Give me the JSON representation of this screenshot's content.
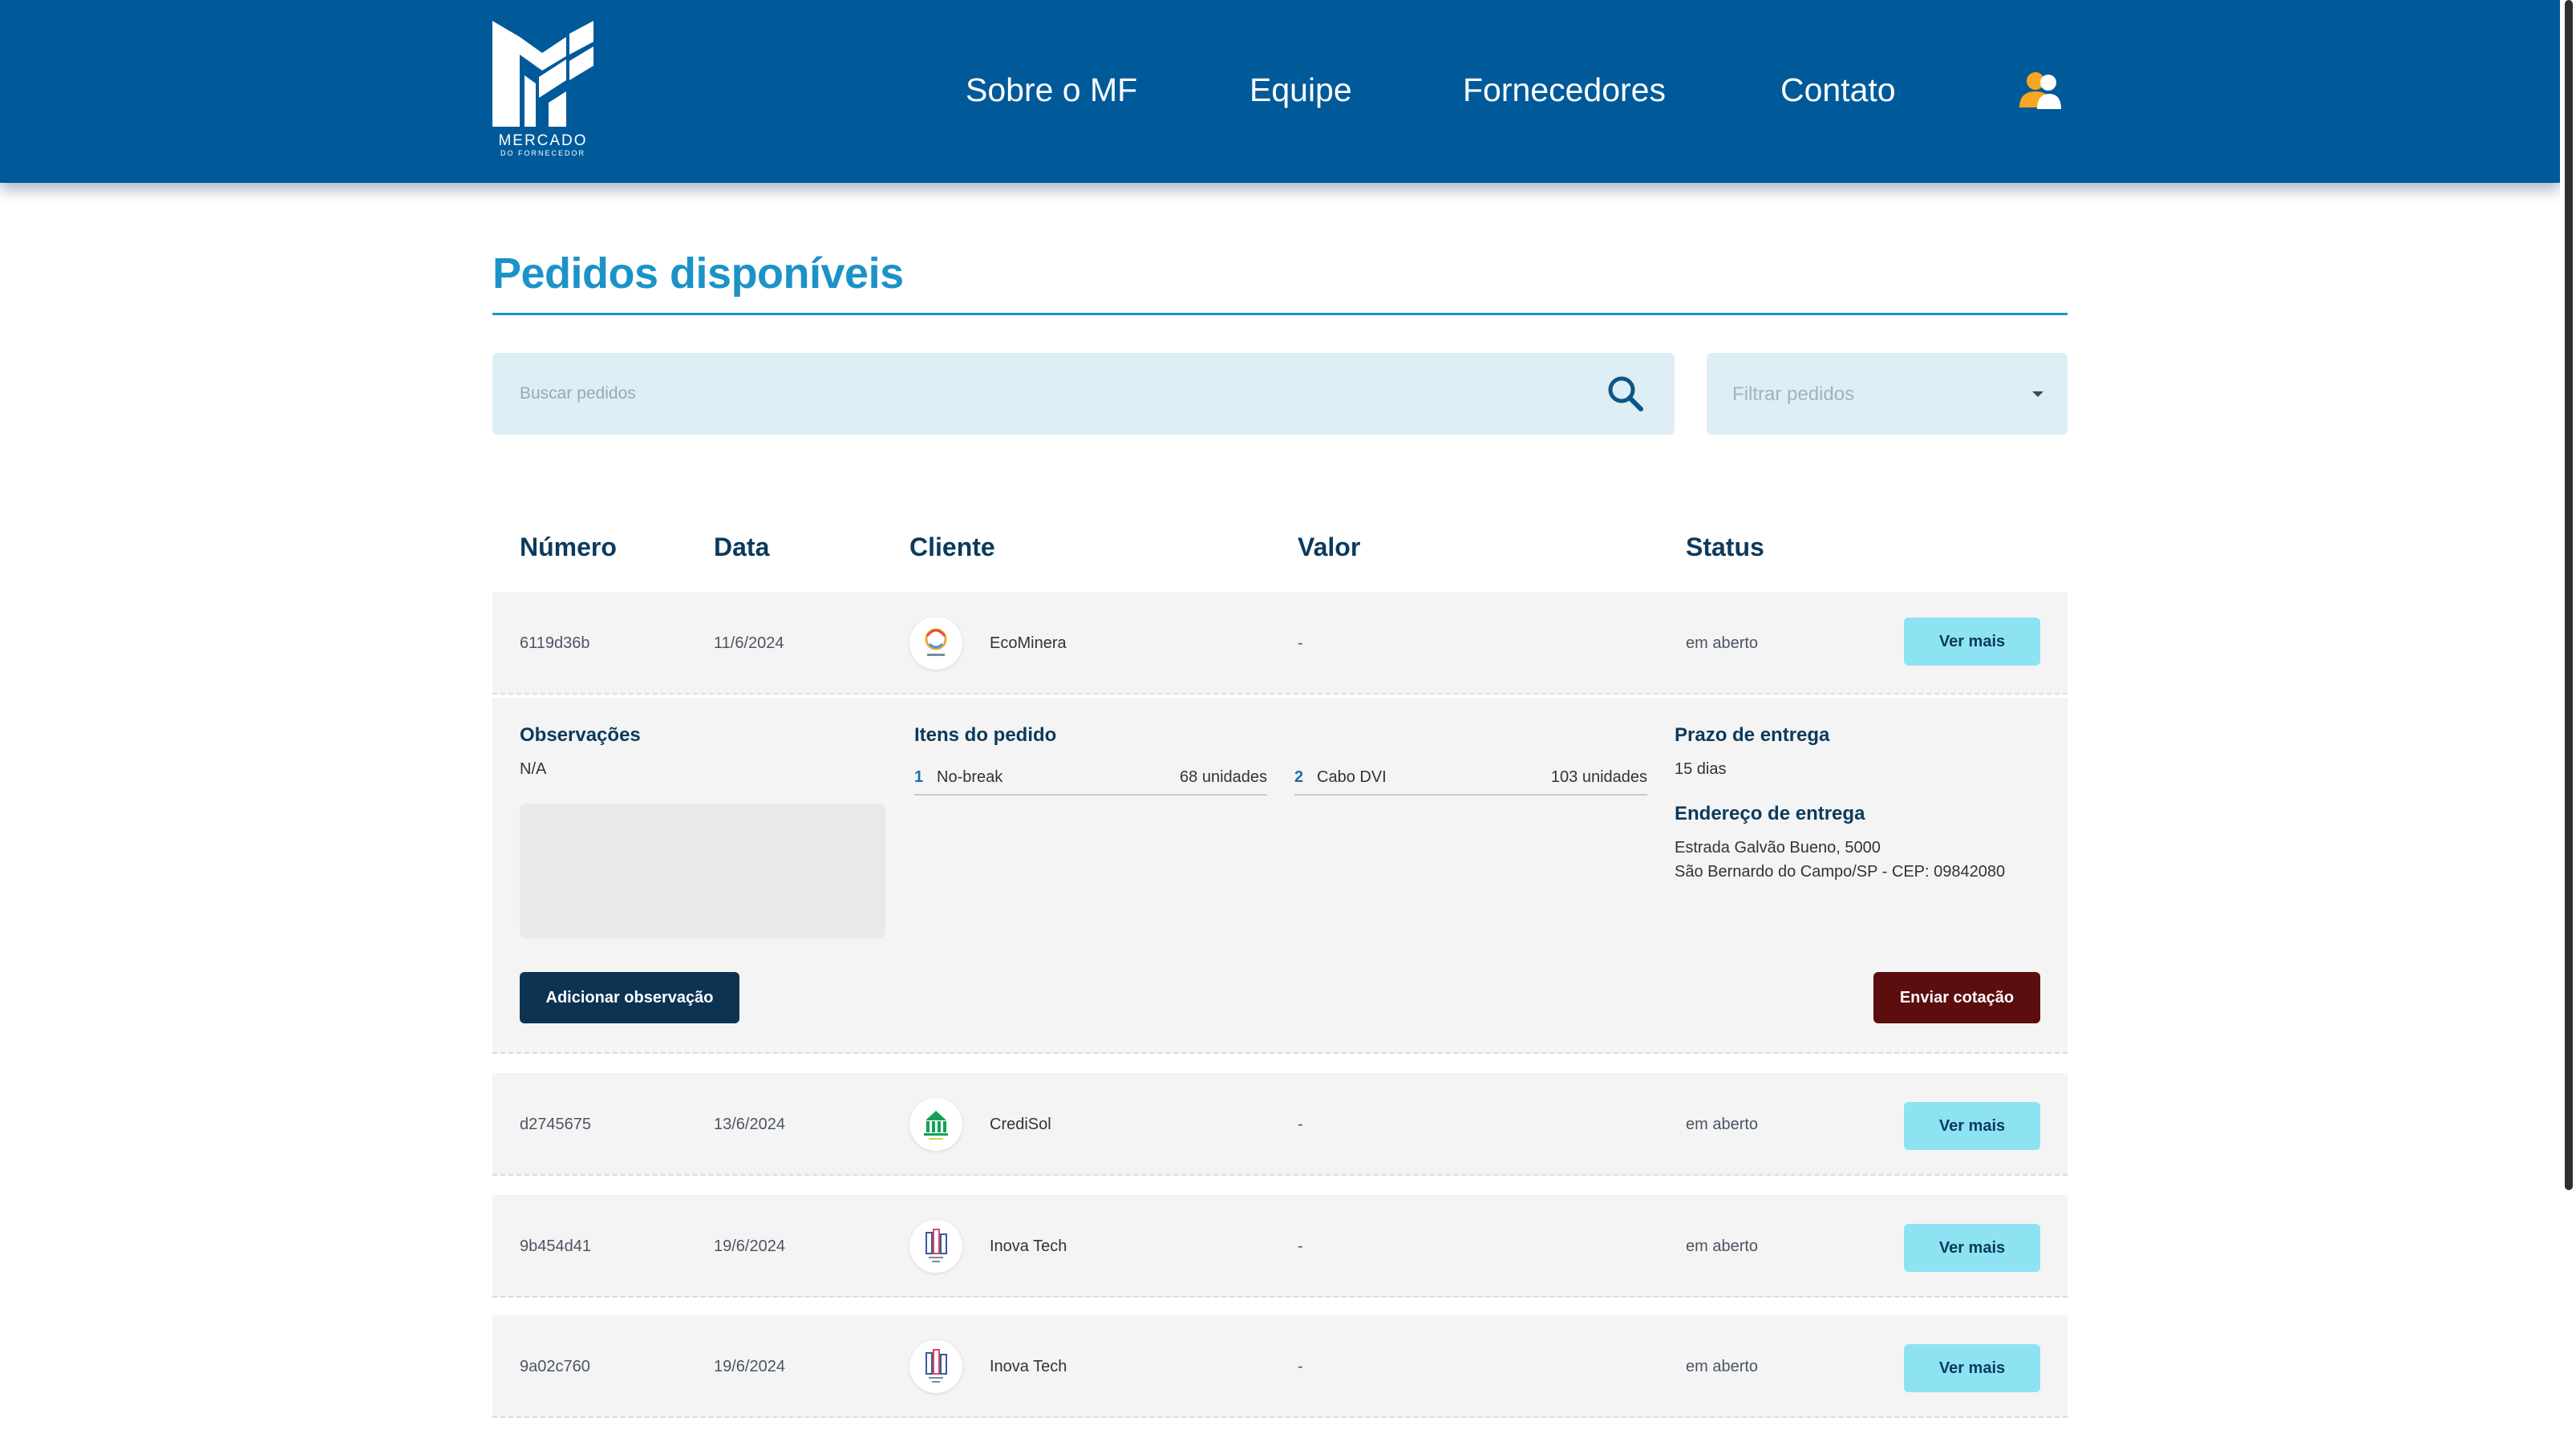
{
  "header": {
    "logo_text": "MERCADO",
    "logo_subtext": "DO FORNECEDOR",
    "nav": [
      "Sobre o MF",
      "Equipe",
      "Fornecedores",
      "Contato"
    ],
    "user_icon": "users-icon",
    "brand_color": "#005a9a"
  },
  "page": {
    "title": "Pedidos disponíveis",
    "accent_color": "#1b93c7"
  },
  "search": {
    "placeholder": "Buscar pedidos",
    "value": "",
    "icon": "search-icon"
  },
  "filter": {
    "label": "Filtrar pedidos",
    "icon": "caret-down-icon"
  },
  "table": {
    "columns": [
      "Número",
      "Data",
      "Cliente",
      "Valor",
      "Status"
    ],
    "action_label": "Ver mais",
    "rows": [
      {
        "numero": "6119d36b",
        "data": "11/6/2024",
        "cliente": "EcoMinera",
        "valor": "-",
        "status": "em aberto",
        "expanded": true
      },
      {
        "numero": "d2745675",
        "data": "13/6/2024",
        "cliente": "CrediSol",
        "valor": "-",
        "status": "em aberto",
        "expanded": false
      },
      {
        "numero": "9b454d41",
        "data": "19/6/2024",
        "cliente": "Inova Tech",
        "valor": "-",
        "status": "em aberto",
        "expanded": false
      },
      {
        "numero": "9a02c760",
        "data": "19/6/2024",
        "cliente": "Inova Tech",
        "valor": "-",
        "status": "em aberto",
        "expanded": false
      }
    ]
  },
  "details": {
    "observacoes_title": "Observações",
    "observacoes_value": "N/A",
    "observacao_input_value": "",
    "itens_title": "Itens do pedido",
    "itens": [
      {
        "num": "1",
        "name": "No-break",
        "qty": "68 unidades"
      },
      {
        "num": "2",
        "name": "Cabo DVI",
        "qty": "103 unidades"
      }
    ],
    "prazo_title": "Prazo de entrega",
    "prazo_value": "15 dias",
    "endereco_title": "Endereço de entrega",
    "endereco_line1": "Estrada Galvão Bueno, 5000",
    "endereco_line2": "São Bernardo do Campo/SP - CEP: 09842080",
    "add_obs_label": "Adicionar observação",
    "enviar_label": "Enviar cotação"
  }
}
